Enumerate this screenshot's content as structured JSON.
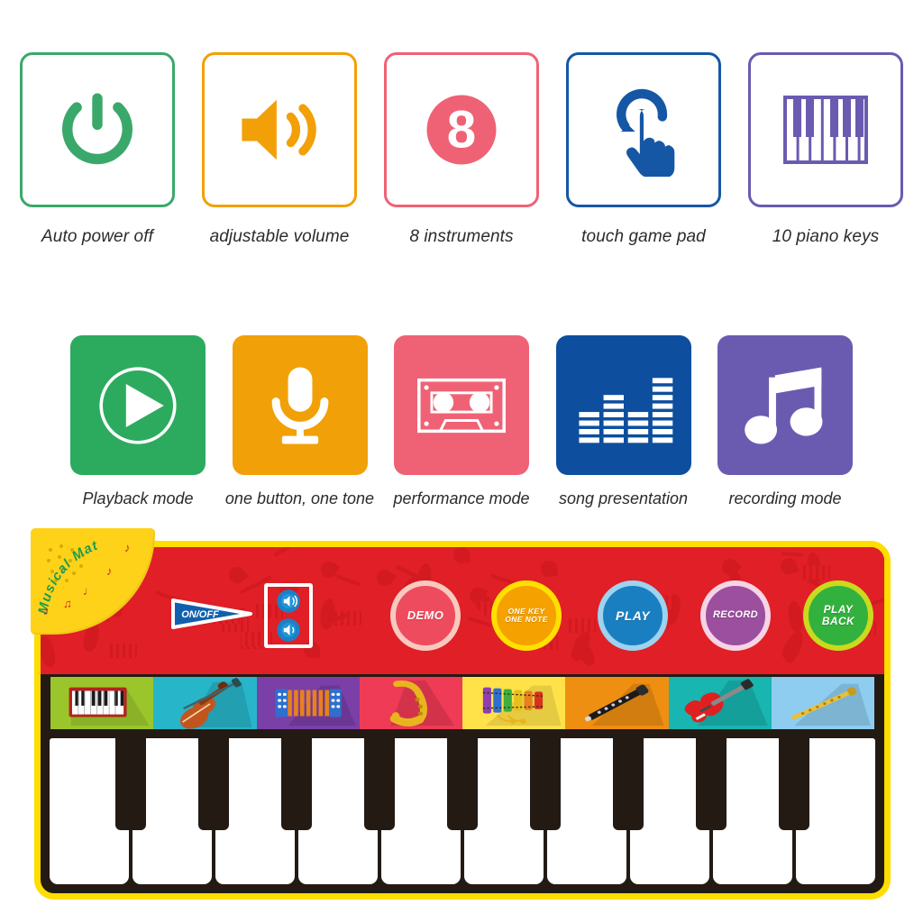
{
  "features_outline": [
    {
      "label": "Auto power off",
      "icon": "power-icon",
      "color": "#3aa86a"
    },
    {
      "label": "adjustable volume",
      "icon": "speaker-volume-icon",
      "color": "#f2a007"
    },
    {
      "label": "8 instruments",
      "icon": "number-eight-circle-icon",
      "color": "#ef6275",
      "value": "8"
    },
    {
      "label": "touch game pad",
      "icon": "touch-hand-icon",
      "color": "#1557a5"
    },
    {
      "label": "10 piano keys",
      "icon": "piano-keys-icon",
      "color": "#6b5bb0"
    }
  ],
  "features_solid": [
    {
      "label": "Playback mode",
      "icon": "play-circle-icon",
      "color": "#2cab5e"
    },
    {
      "label": "one button, one tone",
      "icon": "microphone-icon",
      "color": "#f2a007"
    },
    {
      "label": "performance mode",
      "icon": "cassette-tape-icon",
      "color": "#ef6275"
    },
    {
      "label": "song presentation",
      "icon": "equalizer-icon",
      "color": "#0d4f9e"
    },
    {
      "label": "recording mode",
      "icon": "music-note-icon",
      "color": "#6b5bb0"
    }
  ],
  "product": {
    "brand": "Musical Mat",
    "brand_color": "#1f9d4d",
    "mat_border_color": "#ffdd00",
    "mat_panel_color": "#e01f26",
    "onoff_label": "ON/OFF",
    "buttons": [
      {
        "label": "DEMO",
        "fill": "#ef4b5e",
        "ring": "#f7c9bf",
        "lines": [
          "DEMO"
        ]
      },
      {
        "label": "ONE KEY ONE NOTE",
        "fill": "#f5a100",
        "ring": "#ffe000",
        "lines": [
          "ONE KEY",
          "ONE NOTE"
        ]
      },
      {
        "label": "PLAY",
        "fill": "#1a7fc1",
        "ring": "#9dd3ef",
        "lines": [
          "PLAY"
        ]
      },
      {
        "label": "RECORD",
        "fill": "#9b4f9e",
        "ring": "#f7d3e6",
        "lines": [
          "RECORD"
        ]
      },
      {
        "label": "PLAY BACK",
        "fill": "#33b13e",
        "ring": "#cada1d",
        "lines": [
          "PLAY",
          "BACK"
        ]
      }
    ],
    "instruments": [
      {
        "name": "piano",
        "bg": "#9ac62c"
      },
      {
        "name": "violin",
        "bg": "#27b6c9"
      },
      {
        "name": "accordion",
        "bg": "#7b3fa8"
      },
      {
        "name": "saxophone",
        "bg": "#ef3b56"
      },
      {
        "name": "xylophone",
        "bg": "#ffe24a"
      },
      {
        "name": "clarinet",
        "bg": "#ef8f12"
      },
      {
        "name": "electric-guitar",
        "bg": "#19b5b0"
      },
      {
        "name": "flute",
        "bg": "#8ecdf0"
      }
    ],
    "piano": {
      "white_keys": 10,
      "black_keys": 9
    }
  }
}
